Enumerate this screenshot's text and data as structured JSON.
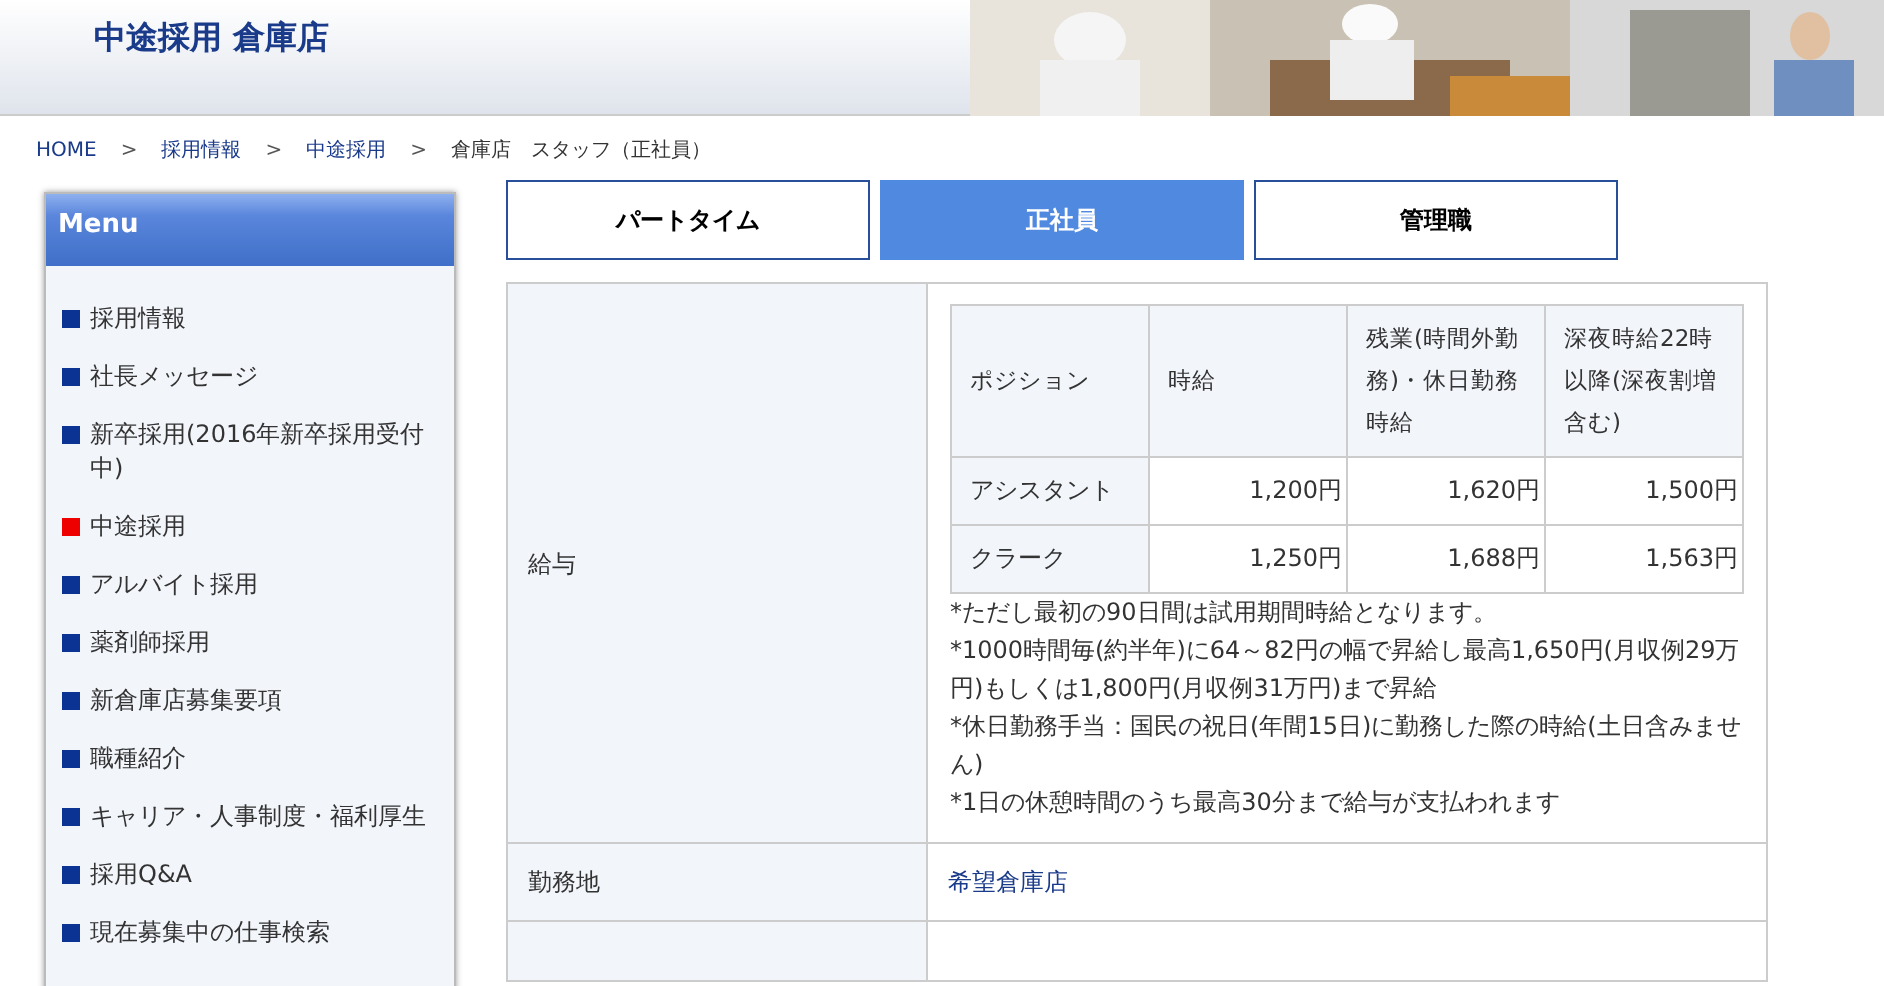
{
  "header": {
    "title": "中途採用 倉庫店"
  },
  "breadcrumb": [
    {
      "label": "HOME",
      "kind": "link"
    },
    {
      "label": "採用情報",
      "kind": "link"
    },
    {
      "label": "中途採用",
      "kind": "link"
    },
    {
      "label": "倉庫店　スタッフ（正社員）",
      "kind": "current"
    }
  ],
  "breadcrumb_separator": ">",
  "sidebar": {
    "title": "Menu",
    "items": [
      {
        "label": "採用情報",
        "selected": false
      },
      {
        "label": "社長メッセージ",
        "selected": false
      },
      {
        "label": "新卒採用(2016年新卒採用受付中)",
        "selected": false
      },
      {
        "label": "中途採用",
        "selected": true
      },
      {
        "label": "アルバイト採用",
        "selected": false
      },
      {
        "label": "薬剤師採用",
        "selected": false
      },
      {
        "label": "新倉庫店募集要項",
        "selected": false
      },
      {
        "label": "職種紹介",
        "selected": false
      },
      {
        "label": "キャリア・人事制度・福利厚生",
        "selected": false
      },
      {
        "label": "採用Q&A",
        "selected": false
      },
      {
        "label": "現在募集中の仕事検索",
        "selected": false
      }
    ]
  },
  "tabs": [
    {
      "label": "パートタイム",
      "selected": false
    },
    {
      "label": "正社員",
      "selected": true
    },
    {
      "label": "管理職",
      "selected": false
    }
  ],
  "details": [
    {
      "label": "給与",
      "kind": "salary",
      "table": {
        "columns": [
          "ポジション",
          "時給",
          "残業(時間外勤務)・休日勤務時給",
          "深夜時給22時以降(深夜割増含む)"
        ],
        "rows": [
          [
            "アシスタント",
            "1,200円",
            "1,620円",
            "1,500円"
          ],
          [
            "クラーク",
            "1,250円",
            "1,688円",
            "1,563円"
          ]
        ]
      },
      "notes": [
        "*ただし最初の90日間は試用期間時給となります。",
        "*1000時間毎(約半年)に64～82円の幅で昇給し最高1,650円(月収例29万円)もしくは1,800円(月収例31万円)まで昇給",
        "*休日勤務手当：国民の祝日(年間15日)に勤務した際の時給(土日含みません)",
        "*1日の休憩時間のうち最高30分まで給与が支払われます"
      ]
    },
    {
      "label": "勤務地",
      "kind": "link",
      "value": "希望倉庫店"
    },
    {
      "kind": "empty"
    }
  ]
}
